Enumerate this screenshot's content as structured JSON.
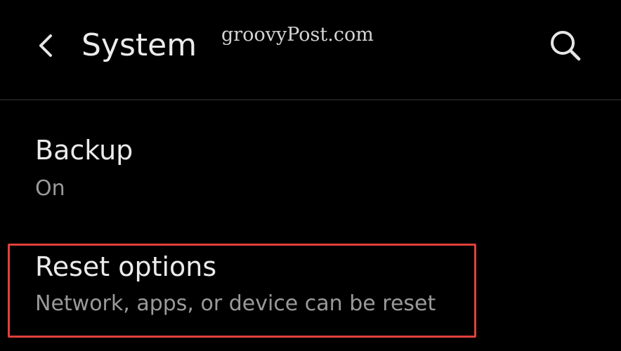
{
  "header": {
    "back_icon": "chevron-left-icon",
    "title": "System",
    "search_icon": "search-icon"
  },
  "watermark": {
    "text": "groovyPost.com"
  },
  "settings": {
    "items": [
      {
        "title": "Backup",
        "summary": "On"
      },
      {
        "title": "Reset options",
        "summary": "Network, apps, or device can be reset"
      }
    ]
  },
  "colors": {
    "background": "#000000",
    "title_text": "#ececec",
    "summary_text": "#9a9a9a",
    "highlight_border": "#e0403c",
    "divider": "#1c1c1c"
  }
}
